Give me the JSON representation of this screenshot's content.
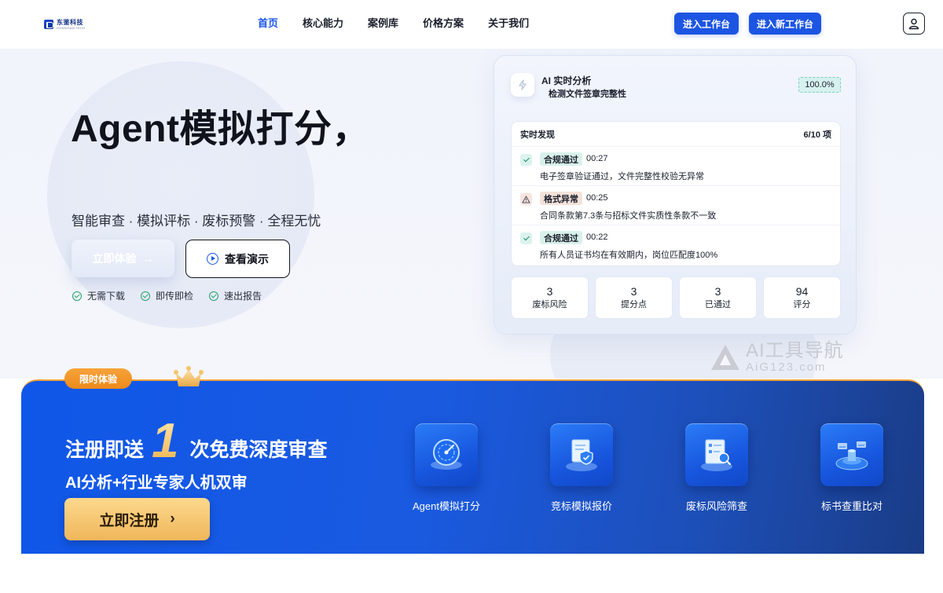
{
  "logo": {
    "name_cn": "东鉴科技",
    "name_en": "DONGJIAN TECH"
  },
  "nav": {
    "items": [
      {
        "label": "首页",
        "active": true
      },
      {
        "label": "核心能力",
        "active": false
      },
      {
        "label": "案例库",
        "active": false
      },
      {
        "label": "价格方案",
        "active": false
      },
      {
        "label": "关于我们",
        "active": false
      }
    ],
    "btn_workbench": "进入工作台",
    "btn_new_workbench": "进入新工作台",
    "user_icon": "user-icon"
  },
  "hero": {
    "title": "Agent模拟打分，",
    "subtitle": "智能审查 · 模拟评标 · 废标预警 · 全程无忧",
    "cta_primary": "立即体验",
    "cta_primary_arrow": "→",
    "cta_secondary": "查看演示",
    "features": [
      "无需下载",
      "即传即检",
      "速出报告"
    ]
  },
  "analysis": {
    "title": "AI 实时分析",
    "subtitle": "检测文件签章完整性",
    "progress": "100.0%",
    "findings_title": "实时发现",
    "findings_count": "6/10 项",
    "findings": [
      {
        "type": "ok",
        "tag": "合规通过",
        "time": "00:27",
        "desc": "电子签章验证通过，文件完整性校验无异常"
      },
      {
        "type": "warn",
        "tag": "格式异常",
        "time": "00:25",
        "desc": "合同条款第7.3条与招标文件实质性条款不一致"
      },
      {
        "type": "ok",
        "tag": "合规通过",
        "time": "00:22",
        "desc": "所有人员证书均在有效期内，岗位匹配度100%"
      }
    ],
    "stats": [
      {
        "value": "3",
        "label": "废标风险"
      },
      {
        "value": "3",
        "label": "提分点"
      },
      {
        "value": "3",
        "label": "已通过"
      },
      {
        "value": "94",
        "label": "评分"
      }
    ]
  },
  "watermark": {
    "main": "AI工具导航",
    "sub": "AiG123.com"
  },
  "promo": {
    "tag": "限时体验",
    "title_before": "注册即送",
    "title_number": "1",
    "title_after": "次免费深度审查",
    "subtitle": "AI分析+行业专家人机双审",
    "button": "立即注册",
    "button_arrow": "›",
    "tools": [
      {
        "label": "Agent模拟打分",
        "icon": "radar-gauge-icon"
      },
      {
        "label": "竞标模拟报价",
        "icon": "document-shield-icon"
      },
      {
        "label": "废标风险筛查",
        "icon": "checklist-search-icon"
      },
      {
        "label": "标书查重比对",
        "icon": "data-platform-icon"
      }
    ]
  },
  "colors": {
    "primary": "#1d55e3",
    "accent_gold": "#f0b65a",
    "success": "#21a06b"
  }
}
